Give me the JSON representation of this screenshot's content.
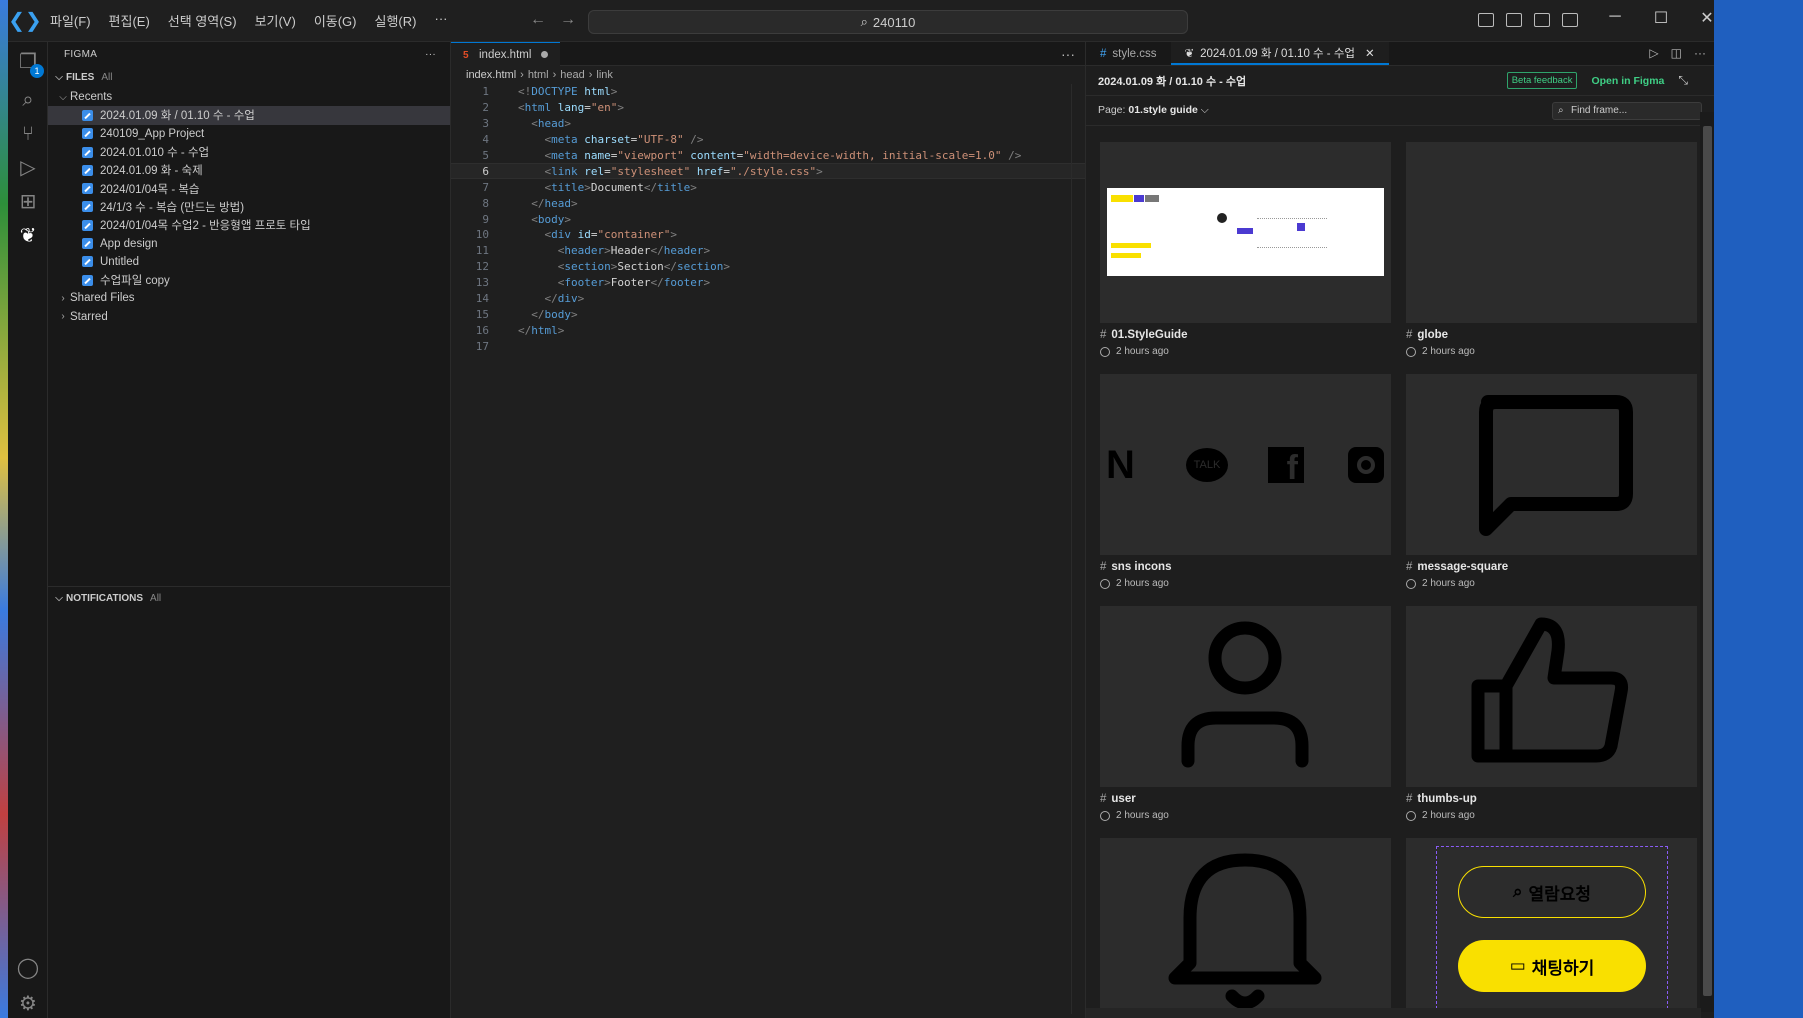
{
  "menu": {
    "items": [
      "파일(F)",
      "편집(E)",
      "선택 영역(S)",
      "보기(V)",
      "이동(G)",
      "실행(R)"
    ]
  },
  "search": {
    "text": "240110"
  },
  "activity": {
    "badge": "1"
  },
  "sidebar": {
    "title": "FIGMA",
    "files_label": "FILES",
    "files_all": "All",
    "recents_label": "Recents",
    "recents": [
      "2024.01.09 화 / 01.10 수 - 수업",
      "240109_App Project",
      "2024.01.010 수 - 수업",
      "2024.01.09 화 - 숙제",
      "2024/01/04목 - 복습",
      "24/1/3 수 - 복습 (만드는 방법)",
      "2024/01/04목 수업2 - 반응형앱 프로토 타입",
      "App design",
      "Untitled",
      "수업파일 copy"
    ],
    "shared": "Shared Files",
    "starred": "Starred",
    "notifications_label": "NOTIFICATIONS",
    "notifications_all": "All"
  },
  "editor": {
    "tab": "index.html",
    "crumbs": [
      "index.html",
      "html",
      "head",
      "link"
    ],
    "lines": [
      [
        [
          "p",
          "<!"
        ],
        [
          "t",
          "DOCTYPE"
        ],
        [
          "x",
          " "
        ],
        [
          "a",
          "html"
        ],
        [
          "p",
          ">"
        ]
      ],
      [
        [
          "p",
          "<"
        ],
        [
          "t",
          "html"
        ],
        [
          "x",
          " "
        ],
        [
          "a",
          "lang"
        ],
        [
          "x",
          "="
        ],
        [
          "s",
          "\"en\""
        ],
        [
          "p",
          ">"
        ]
      ],
      [
        [
          "x",
          "  "
        ],
        [
          "p",
          "<"
        ],
        [
          "t",
          "head"
        ],
        [
          "p",
          ">"
        ]
      ],
      [
        [
          "x",
          "    "
        ],
        [
          "p",
          "<"
        ],
        [
          "t",
          "meta"
        ],
        [
          "x",
          " "
        ],
        [
          "a",
          "charset"
        ],
        [
          "x",
          "="
        ],
        [
          "s",
          "\"UTF-8\""
        ],
        [
          "x",
          " "
        ],
        [
          "p",
          "/>"
        ]
      ],
      [
        [
          "x",
          "    "
        ],
        [
          "p",
          "<"
        ],
        [
          "t",
          "meta"
        ],
        [
          "x",
          " "
        ],
        [
          "a",
          "name"
        ],
        [
          "x",
          "="
        ],
        [
          "s",
          "\"viewport\""
        ],
        [
          "x",
          " "
        ],
        [
          "a",
          "content"
        ],
        [
          "x",
          "="
        ],
        [
          "s",
          "\"width=device-width, initial-scale=1.0\""
        ],
        [
          "x",
          " "
        ],
        [
          "p",
          "/>"
        ]
      ],
      [
        [
          "x",
          "    "
        ],
        [
          "p",
          "<"
        ],
        [
          "t",
          "link"
        ],
        [
          "x",
          " "
        ],
        [
          "a",
          "rel"
        ],
        [
          "x",
          "="
        ],
        [
          "s",
          "\"stylesheet\""
        ],
        [
          "x",
          " "
        ],
        [
          "a",
          "href"
        ],
        [
          "x",
          "="
        ],
        [
          "s",
          "\"./style.css\""
        ],
        [
          "p",
          ">"
        ]
      ],
      [
        [
          "x",
          "    "
        ],
        [
          "p",
          "<"
        ],
        [
          "t",
          "title"
        ],
        [
          "p",
          ">"
        ],
        [
          "x",
          "Document"
        ],
        [
          "p",
          "</"
        ],
        [
          "t",
          "title"
        ],
        [
          "p",
          ">"
        ]
      ],
      [
        [
          "x",
          "  "
        ],
        [
          "p",
          "</"
        ],
        [
          "t",
          "head"
        ],
        [
          "p",
          ">"
        ]
      ],
      [
        [
          "x",
          "  "
        ],
        [
          "p",
          "<"
        ],
        [
          "t",
          "body"
        ],
        [
          "p",
          ">"
        ]
      ],
      [
        [
          "x",
          "    "
        ],
        [
          "p",
          "<"
        ],
        [
          "t",
          "div"
        ],
        [
          "x",
          " "
        ],
        [
          "a",
          "id"
        ],
        [
          "x",
          "="
        ],
        [
          "s",
          "\"container\""
        ],
        [
          "p",
          ">"
        ]
      ],
      [
        [
          "x",
          "      "
        ],
        [
          "p",
          "<"
        ],
        [
          "t",
          "header"
        ],
        [
          "p",
          ">"
        ],
        [
          "x",
          "Header"
        ],
        [
          "p",
          "</"
        ],
        [
          "t",
          "header"
        ],
        [
          "p",
          ">"
        ]
      ],
      [
        [
          "x",
          "      "
        ],
        [
          "p",
          "<"
        ],
        [
          "t",
          "section"
        ],
        [
          "p",
          ">"
        ],
        [
          "x",
          "Section"
        ],
        [
          "p",
          "</"
        ],
        [
          "t",
          "section"
        ],
        [
          "p",
          ">"
        ]
      ],
      [
        [
          "x",
          "      "
        ],
        [
          "p",
          "<"
        ],
        [
          "t",
          "footer"
        ],
        [
          "p",
          ">"
        ],
        [
          "x",
          "Footer"
        ],
        [
          "p",
          "</"
        ],
        [
          "t",
          "footer"
        ],
        [
          "p",
          ">"
        ]
      ],
      [
        [
          "x",
          "    "
        ],
        [
          "p",
          "</"
        ],
        [
          "t",
          "div"
        ],
        [
          "p",
          ">"
        ]
      ],
      [
        [
          "x",
          "  "
        ],
        [
          "p",
          "</"
        ],
        [
          "t",
          "body"
        ],
        [
          "p",
          ">"
        ]
      ],
      [
        [
          "p",
          "</"
        ],
        [
          "t",
          "html"
        ],
        [
          "p",
          ">"
        ]
      ],
      []
    ]
  },
  "figma": {
    "tab1": "style.css",
    "tab2": "2024.01.09 화 / 01.10 수 - 수업",
    "title": "2024.01.09 화 / 01.10 수 - 수업",
    "beta": "Beta feedback",
    "open": "Open in Figma",
    "page_label": "Page:",
    "page_value": "01.style guide",
    "find": "Find frame...",
    "frames": [
      {
        "name": "01.StyleGuide",
        "time": "2 hours ago"
      },
      {
        "name": "globe",
        "time": "2 hours ago"
      },
      {
        "name": "sns incons",
        "time": "2 hours ago"
      },
      {
        "name": "message-square",
        "time": "2 hours ago"
      },
      {
        "name": "user",
        "time": "2 hours ago"
      },
      {
        "name": "thumbs-up",
        "time": "2 hours ago"
      },
      {
        "name": "",
        "time": ""
      },
      {
        "name": "",
        "time": ""
      }
    ],
    "btn_outline": "열람요청",
    "btn_fill": "채팅하기",
    "talk": "TALK"
  },
  "colors": {
    "accent": "#0078d4",
    "figma_green": "#3fcf85",
    "yellow": "#f9e000"
  }
}
